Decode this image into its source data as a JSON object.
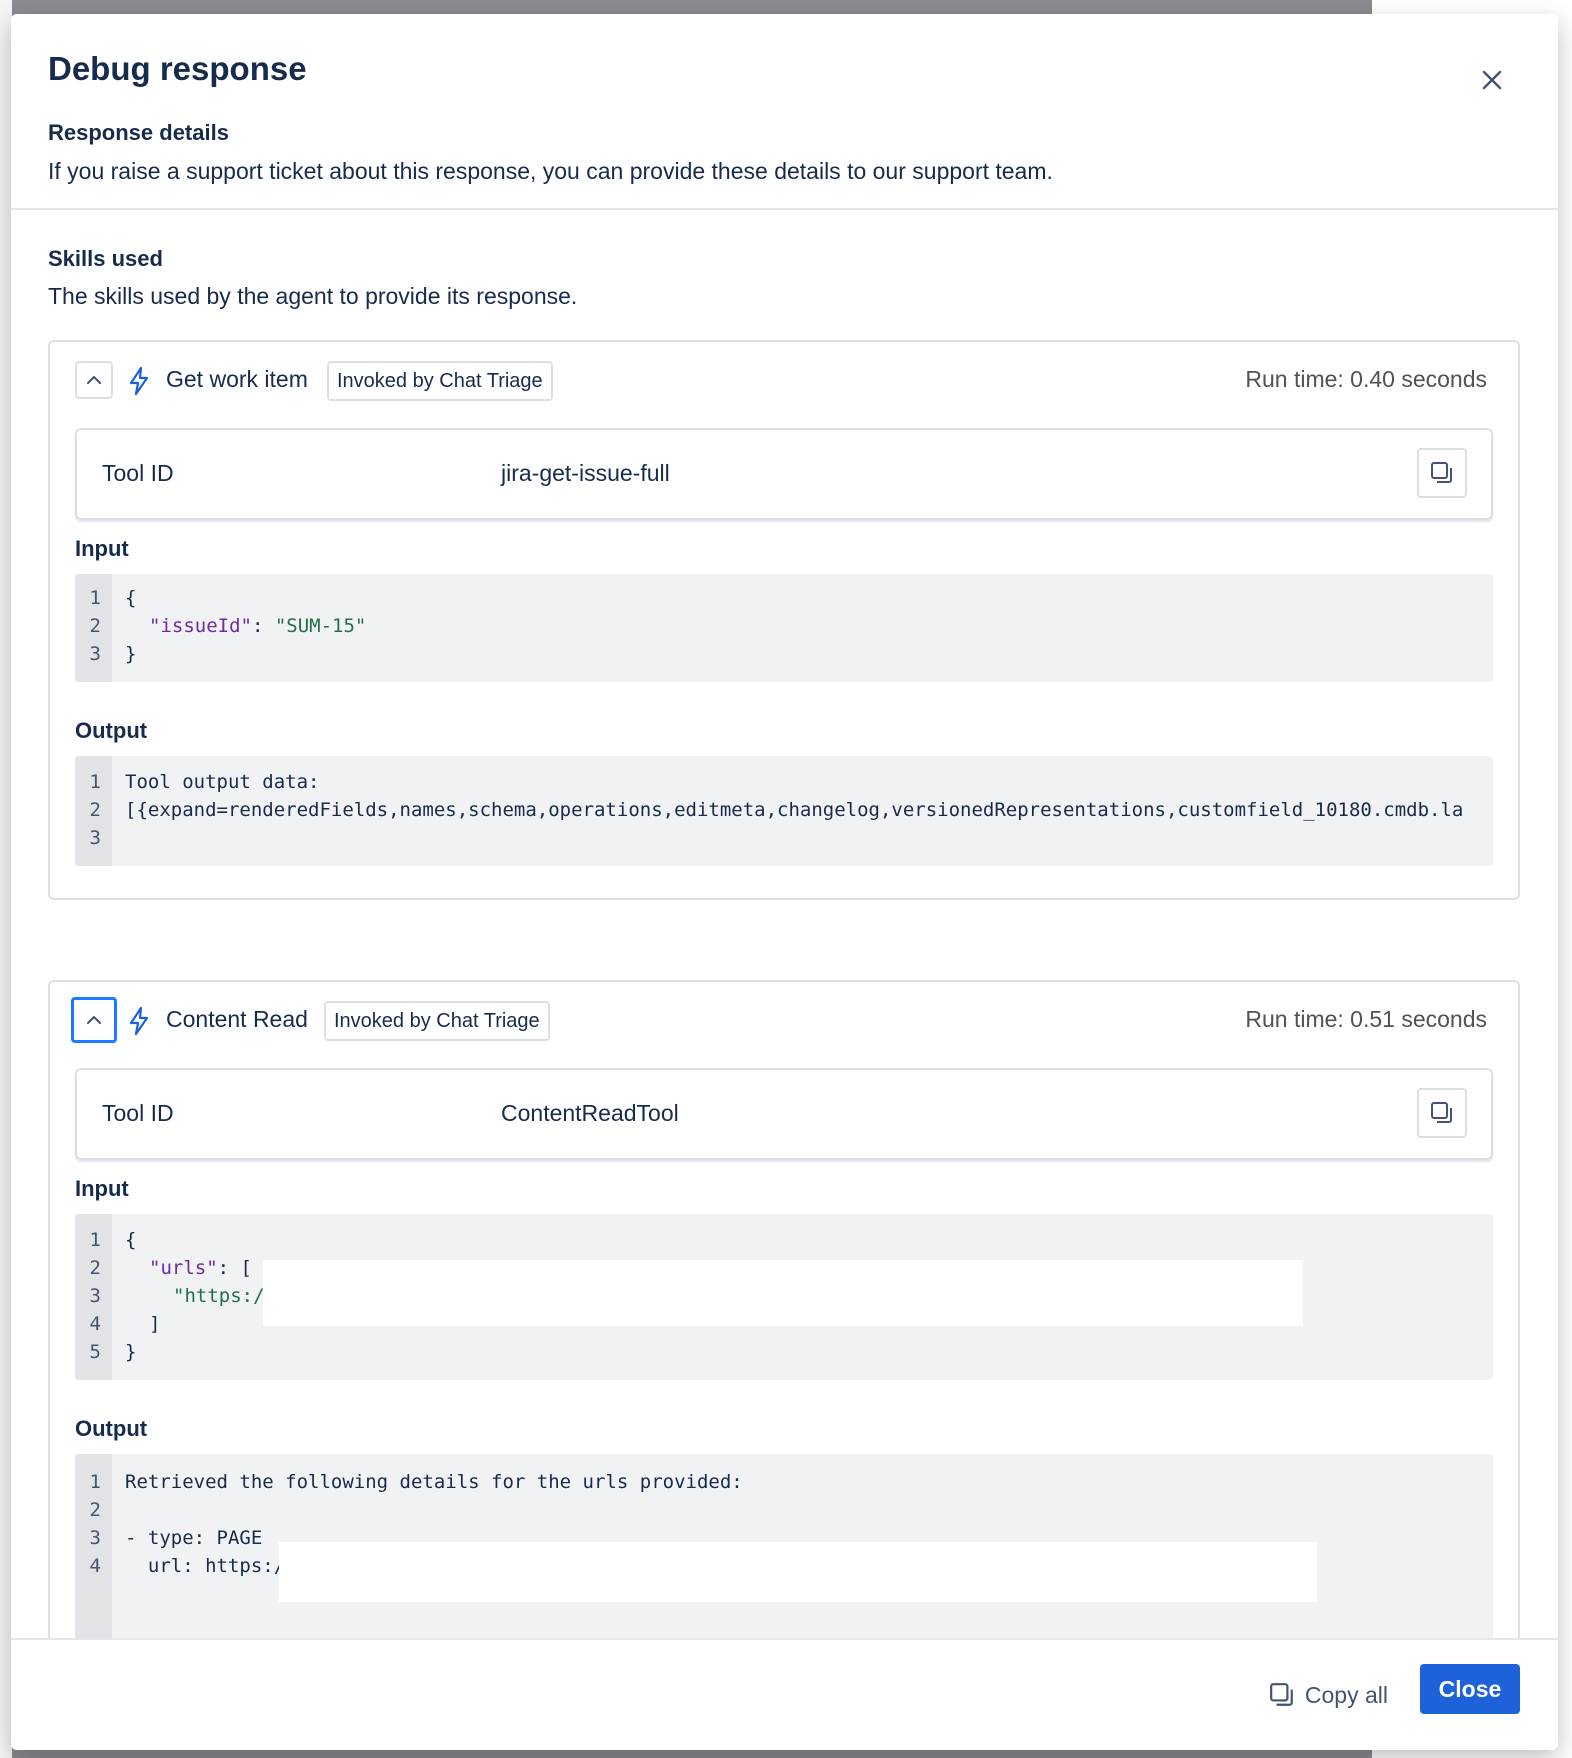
{
  "dialog": {
    "title": "Debug response",
    "response_details_heading": "Response details",
    "response_details_desc": "If you raise a support ticket about this response, you can provide these details to our support team.",
    "skills_heading": "Skills used",
    "skills_desc": "The skills used by the agent to provide its response."
  },
  "skills": [
    {
      "name": "Get work item",
      "invoked_by": "Invoked by Chat Triage",
      "run_time": "Run time: 0.40 seconds",
      "tool_id_label": "Tool ID",
      "tool_id": "jira-get-issue-full",
      "input_label": "Input",
      "output_label": "Output",
      "input_lines": [
        "1",
        "2",
        "3"
      ],
      "output_lines": [
        "1",
        "2",
        "3"
      ],
      "output_line1": "Tool output data:",
      "output_line2": "[{expand=renderedFields,names,schema,operations,editmeta,changelog,versionedRepresentations,customfield_10180.cmdb.la"
    },
    {
      "name": "Content Read",
      "invoked_by": "Invoked by Chat Triage",
      "run_time": "Run time: 0.51 seconds",
      "tool_id_label": "Tool ID",
      "tool_id": "ContentReadTool",
      "input_label": "Input",
      "output_label": "Output",
      "input_lines": [
        "1",
        "2",
        "3",
        "4",
        "5"
      ],
      "output_lines": [
        "1",
        "2",
        "3",
        "4"
      ],
      "output_line1": "Retrieved the following details for the urls provided:",
      "output_line3": "- type: PAGE",
      "output_line4": "  url: https:/"
    }
  ],
  "code": {
    "brace_open": "{",
    "brace_close": "}",
    "issue_key": "\"issueId\"",
    "issue_val": "\"SUM-15\"",
    "colon": ": ",
    "urls_key": "\"urls\"",
    "bracket_open": ": [",
    "url_val": "\"https:/",
    "bracket_close": "]"
  },
  "footer": {
    "copy_all": "Copy all",
    "close": "Close"
  },
  "colors": {
    "primary": "#1d62d9",
    "focus": "#1d7afc",
    "code_key": "#6e2a9e",
    "code_string": "#216e4e"
  },
  "icons": {
    "close": "close-icon",
    "bolt": "bolt-icon",
    "chevron": "chevron-up-icon",
    "copy": "copy-icon"
  }
}
